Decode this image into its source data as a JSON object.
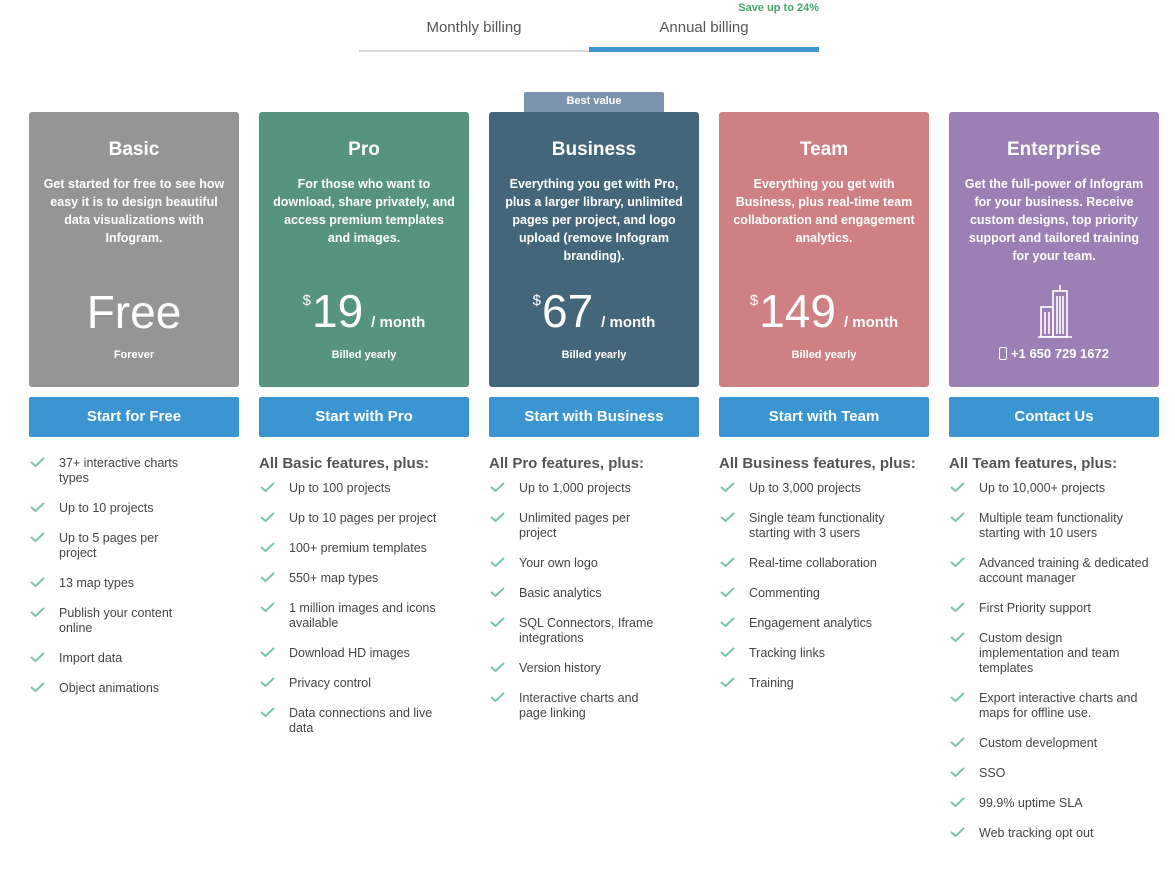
{
  "billing": {
    "monthly_label": "Monthly billing",
    "annual_label": "Annual billing",
    "save_label": "Save up to 24%",
    "selected": "annual"
  },
  "badge": "Best value",
  "colors": {
    "basic": "#959595",
    "pro": "#56957c",
    "business": "#44667b",
    "team": "#ce8082",
    "enterprise": "#9b7fb5",
    "button": "#3a95d1",
    "check": "#7ac6a4"
  },
  "plans": [
    {
      "name": "Basic",
      "description": "Get started for free to see how easy it is to design beautiful data visualizations with Infogram.",
      "price_text": "Free",
      "sub": "Forever",
      "button": "Start for Free",
      "features_heading": "",
      "features": [
        "37+ interactive charts types",
        "Up to 10 projects",
        "Up to 5 pages per project",
        "13 map types",
        "Publish your content online",
        "Import data",
        "Object animations"
      ]
    },
    {
      "name": "Pro",
      "description": "For those who want to download, share privately, and access premium templates and images.",
      "currency": "$",
      "amount": "19",
      "per": "/ month",
      "sub": "Billed yearly",
      "button": "Start with Pro",
      "features_heading": "All Basic features, plus:",
      "features": [
        "Up to 100 projects",
        "Up to 10 pages per project",
        "100+ premium templates",
        "550+ map types",
        "1 million images and icons available",
        "Download HD images",
        "Privacy control",
        "Data connections and live data"
      ]
    },
    {
      "name": "Business",
      "description": "Everything you get with Pro, plus a larger library, unlimited pages per project, and logo upload (remove Infogram branding).",
      "currency": "$",
      "amount": "67",
      "per": "/ month",
      "sub": "Billed yearly",
      "button": "Start with Business",
      "features_heading": "All Pro features, plus:",
      "features": [
        "Up to 1,000 projects",
        "Unlimited pages per project",
        "Your own logo",
        "Basic analytics",
        "SQL Connectors, Iframe integrations",
        "Version history",
        "Interactive charts and page linking"
      ]
    },
    {
      "name": "Team",
      "description": "Everything you get with Business, plus real-time team collaboration and engagement analytics.",
      "currency": "$",
      "amount": "149",
      "per": "/ month",
      "sub": "Billed yearly",
      "button": "Start with Team",
      "features_heading": "All Business features, plus:",
      "features": [
        "Up to 3,000 projects",
        "Single team functionality starting with 3 users",
        "Real-time collaboration",
        "Commenting",
        "Engagement analytics",
        "Tracking links",
        "Training"
      ]
    },
    {
      "name": "Enterprise",
      "description": "Get the full-power of Infogram for your business. Receive custom designs, top priority support and tailored training for your team.",
      "phone": "+1 650 729 1672",
      "button": "Contact Us",
      "features_heading": "All Team features, plus:",
      "features": [
        "Up to 10,000+ projects",
        "Multiple team functionality starting with 10 users",
        "Advanced training & dedicated account manager",
        "First Priority support",
        "Custom design implementation and team templates",
        "Export interactive charts and maps for offline use.",
        "Custom development",
        "SSO",
        "99.9% uptime SLA",
        "Web tracking opt out"
      ]
    }
  ]
}
